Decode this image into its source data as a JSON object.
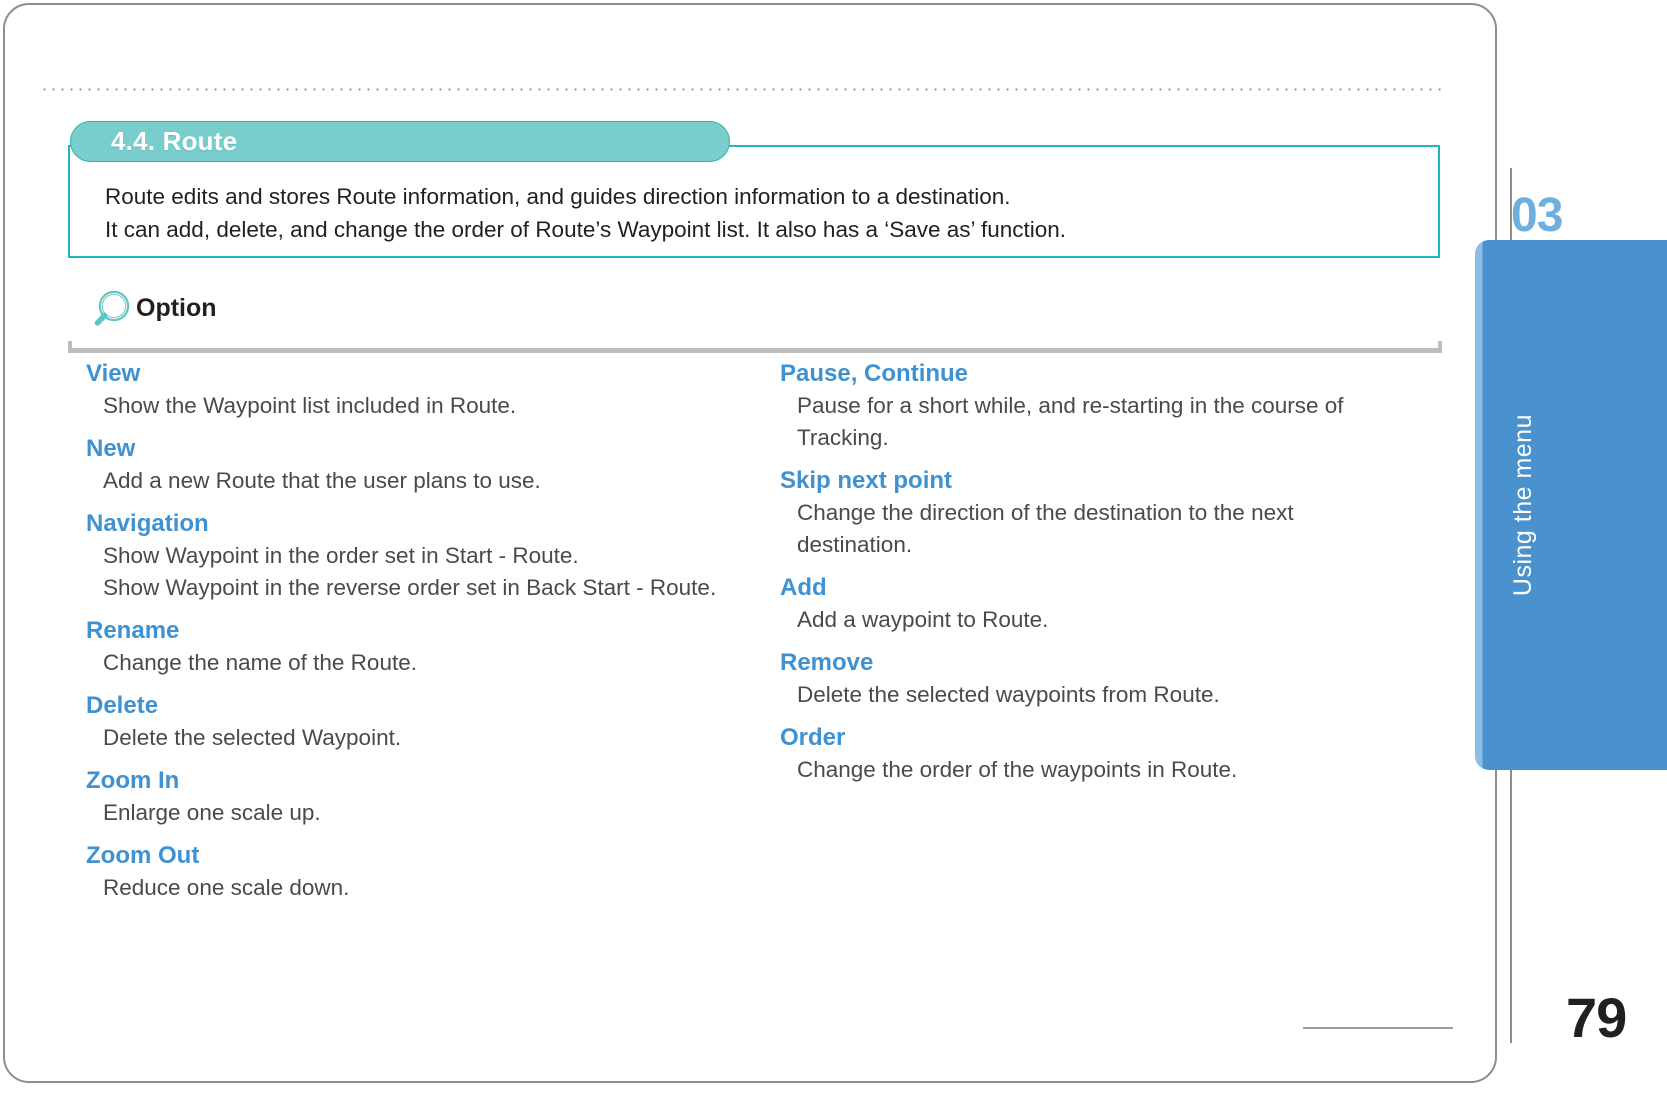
{
  "page": {
    "folio": "79",
    "chapter_number": "03",
    "chapter_tab_label": "Using the menu"
  },
  "section": {
    "badge_label": "4.4. Route",
    "description_lines": [
      "Route edits and stores Route information, and guides direction information to a destination.",
      "It can add, delete, and change the order of Route’s Waypoint list. It also has a ‘Save as’ function."
    ]
  },
  "option_header": {
    "label": "Option",
    "icon": "magnifier-icon"
  },
  "options": {
    "left_column": [
      {
        "term": "View",
        "definition_lines": [
          "Show the Waypoint list included in Route."
        ]
      },
      {
        "term": "New",
        "definition_lines": [
          "Add a new Route that the user plans to use."
        ]
      },
      {
        "term": "Navigation",
        "definition_lines": [
          "Show Waypoint in the order set in Start - Route.",
          "Show Waypoint in the reverse order set in Back Start - Route."
        ]
      },
      {
        "term": "Rename",
        "definition_lines": [
          "Change the name of the Route."
        ]
      },
      {
        "term": "Delete",
        "definition_lines": [
          "Delete the selected Waypoint."
        ]
      },
      {
        "term": "Zoom In",
        "definition_lines": [
          "Enlarge one scale up."
        ]
      },
      {
        "term": "Zoom Out",
        "definition_lines": [
          "Reduce one scale down."
        ]
      }
    ],
    "right_column": [
      {
        "term": "Pause, Continue",
        "definition_lines": [
          "Pause for a short while, and re-starting in the course of",
          "Tracking."
        ]
      },
      {
        "term": "Skip next point",
        "definition_lines": [
          "Change the direction of the destination to the next",
          "destination."
        ]
      },
      {
        "term": "Add",
        "definition_lines": [
          "Add a waypoint to Route."
        ]
      },
      {
        "term": "Remove",
        "definition_lines": [
          "Delete the selected waypoints from Route."
        ]
      },
      {
        "term": "Order",
        "definition_lines": [
          "Change the order of the waypoints in Route."
        ]
      }
    ]
  },
  "colors": {
    "badge_fill": "#79cdcd",
    "badge_border": "#36b0b0",
    "section_box_border": "#23b5bd",
    "term_blue": "#3f92d2",
    "body_gray": "#4a4a4a",
    "tab_blue": "#4a92cd",
    "tab_blue_light": "#8cbde4",
    "rule_gray": "#bcbec0",
    "page_border": "#8d8d90"
  }
}
